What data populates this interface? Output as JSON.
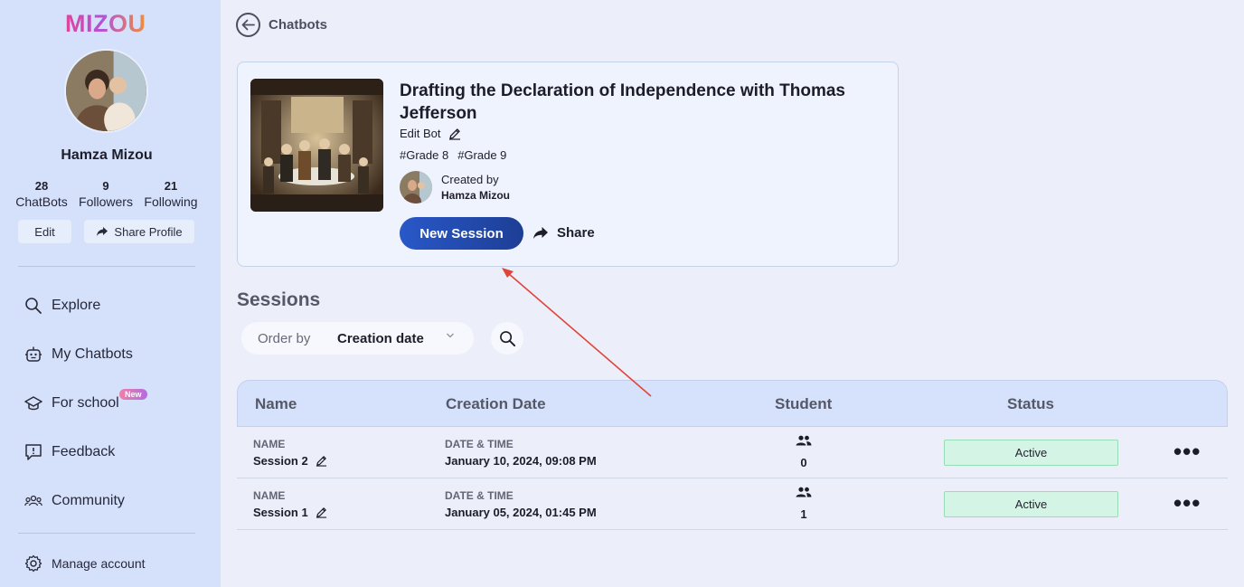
{
  "brand": {
    "logo_text": "MIZOU"
  },
  "profile": {
    "name": "Hamza Mizou",
    "stats": [
      {
        "value": "28",
        "label": "ChatBots"
      },
      {
        "value": "9",
        "label": "Followers"
      },
      {
        "value": "21",
        "label": "Following"
      }
    ],
    "edit_label": "Edit",
    "share_profile_label": "Share Profile"
  },
  "nav": {
    "items": [
      {
        "label": "Explore",
        "icon": "search-icon"
      },
      {
        "label": "My Chatbots",
        "icon": "robot-icon"
      },
      {
        "label": "For school",
        "icon": "graduation-cap-icon",
        "badge": "New"
      },
      {
        "label": "Feedback",
        "icon": "feedback-icon"
      },
      {
        "label": "Community",
        "icon": "community-icon"
      }
    ],
    "manage_account": "Manage account"
  },
  "header": {
    "title": "Chatbots"
  },
  "bot": {
    "title": "Drafting the Declaration of Independence with Thomas Jefferson",
    "edit_label": "Edit Bot",
    "tags": [
      "#Grade 8",
      "#Grade 9"
    ],
    "created_by_label": "Created by",
    "creator_name": "Hamza Mizou",
    "new_session_label": "New Session",
    "share_label": "Share"
  },
  "sessions": {
    "title": "Sessions",
    "order_by_label": "Order by",
    "order_by_value": "Creation date",
    "columns": [
      "Name",
      "Creation Date",
      "Student",
      "Status"
    ],
    "rows": [
      {
        "name_label": "NAME",
        "name": "Session 2",
        "date_label": "DATE & TIME",
        "date": "January 10, 2024, 09:08 PM",
        "students": "0",
        "status": "Active"
      },
      {
        "name_label": "NAME",
        "name": "Session 1",
        "date_label": "DATE & TIME",
        "date": "January 05, 2024, 01:45 PM",
        "students": "1",
        "status": "Active"
      }
    ]
  },
  "colors": {
    "sidebar_bg": "#d5e1fb",
    "page_bg": "#eceff9",
    "primary_button": "#2958c8",
    "status_active_bg": "#d4f4e6",
    "annotation_arrow": "#e0453a"
  }
}
